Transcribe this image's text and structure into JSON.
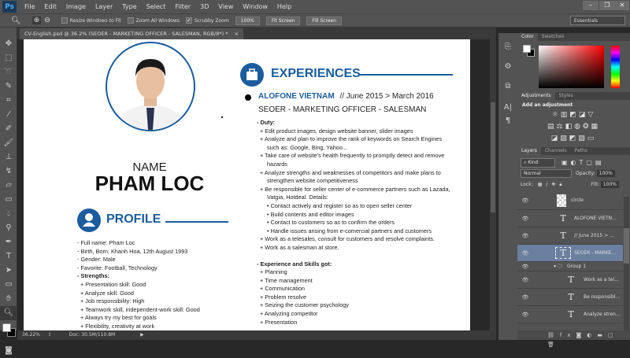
{
  "app": {
    "logo": "Ps",
    "menu": [
      "File",
      "Edit",
      "Image",
      "Layer",
      "Type",
      "Select",
      "Filter",
      "3D",
      "View",
      "Window",
      "Help"
    ],
    "window_controls": [
      "minimize",
      "restore",
      "close"
    ]
  },
  "options": {
    "resize_windows": "Resize Windows to Fit",
    "resize_checked": false,
    "zoom_all": "Zoom All Windows",
    "zoom_all_checked": false,
    "scrubby": "Scrubby Zoom",
    "scrubby_checked": true,
    "btn_100": "100%",
    "fit_screen": "Fit Screen",
    "fill_screen": "Fill Screen",
    "workspace": "Essentials"
  },
  "document": {
    "tab_title": "CV-English.psd @ 36.2% (SEOER - MARKETING OFFICER - SALESMAN, RGB/8*) *"
  },
  "tools": [
    "move-icon",
    "marquee-icon",
    "lasso-icon",
    "quick-select-icon",
    "crop-icon",
    "eyedropper-icon",
    "healing-icon",
    "brush-icon",
    "stamp-icon",
    "history-brush-icon",
    "eraser-icon",
    "gradient-icon",
    "blur-icon",
    "dodge-icon",
    "pen-icon",
    "type-icon",
    "path-select-icon",
    "rectangle-icon",
    "hand-icon",
    "zoom-icon"
  ],
  "status": {
    "zoom": "36.22%",
    "doc": "Doc: 30.5M/110.8M"
  },
  "cv": {
    "name_label": "NAME",
    "name": "PHAM LOC",
    "profile_title": "PROFILE",
    "experiences_title": "EXPERIENCES",
    "profile": [
      "- Full name: Pham Loc",
      "- Birth, Born: Khanh Hoa, 12th August 1993",
      "- Gender: Male",
      "- Favorite: Football, Technology"
    ],
    "strengths_title": "- Strengths:",
    "strengths": [
      "+ Presentation skill: Good",
      "+ Analyze skill: Good",
      "+ Job responsibility: High",
      "+ Teamwork skill, independent-work skill: Good",
      "+ Always try my best for goals",
      "+ Flexibility, creativity at work"
    ],
    "company": "ALOFONE VIETNAM",
    "period": "//  June 2015 > March 2016",
    "position": "SEOER - MARKETING OFFICER - SALESMAN",
    "duty_title": "- Duty:",
    "duties": [
      "+ Edit product images, design website banner, slider images",
      "+ Analyze and plan to improve the rank of keywords on Search Engines",
      "such as: Google, Bing, Yahoo...",
      "+ Take care of website's health frequently to promptly detect and remove",
      "hazards",
      "+ Analyze strengths and weaknesses of competitors and make plans to",
      "strengthen website competitiveness",
      "+ Be responsible for seller center of e-commerce partners such as Lazada,",
      "Vatgia, Hotdeal. Details:"
    ],
    "details": [
      "Contact actively and register so as to open seller center",
      "Build contents and editor images",
      "Contact to customers so as to confirm the orders",
      "Handle issues arising from e-comercial partners and customers"
    ],
    "duties2": [
      "+ Work as a telesales, consult for customers and resolve complaints.",
      "+ Work as a salesman at store."
    ],
    "skills_title": "- Experience and Skills got:",
    "skills": [
      "+ Planning",
      "+ Time management",
      "+ Communication",
      "+ Problem resolve",
      "+ Seizing the customer psychology",
      "+ Analyzing competitor",
      "+ Presentation"
    ]
  },
  "panels": {
    "color_tabs": [
      "Color",
      "Swatches"
    ],
    "adjust_tabs": [
      "Adjustments",
      "Styles"
    ],
    "add_adjustment": "Add an adjustment",
    "layers_tabs": [
      "Layers",
      "Channels",
      "Paths"
    ],
    "kind": "Kind",
    "blend": "Normal",
    "opacity_label": "Opacity:",
    "opacity": "100%",
    "lock_label": "Lock:",
    "fill_label": "Fill:",
    "fill": "100%",
    "layers": [
      {
        "name": "circle",
        "type": "image"
      },
      {
        "name": "ALOFONE VIETN...",
        "type": "text"
      },
      {
        "name": "// June 2015 > ...",
        "type": "text"
      },
      {
        "name": "SEOER - MARKE...",
        "type": "text",
        "selected": true
      },
      {
        "name": "Group 1",
        "type": "group"
      },
      {
        "name": "Work as a tel...",
        "type": "text"
      },
      {
        "name": "Be responsibl...",
        "type": "text"
      },
      {
        "name": "Analyze stren...",
        "type": "text"
      }
    ]
  },
  "colors": {
    "accent": "#1b5c9e",
    "selected_layer": "#6b80a0"
  }
}
